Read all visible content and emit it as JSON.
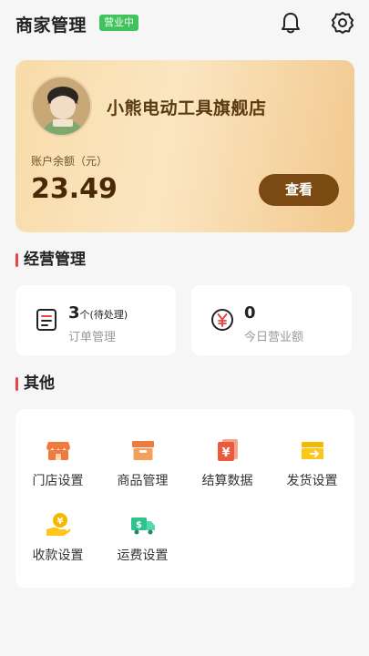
{
  "header": {
    "title": "商家管理",
    "status": "营业中",
    "icons": [
      "bell-icon",
      "gear-icon"
    ]
  },
  "balance_card": {
    "shop_name": "小熊电动工具旗舰店",
    "balance_label": "账户余额（元）",
    "balance_value": "23.49",
    "view_button": "查看"
  },
  "business": {
    "title": "经营管理",
    "orders": {
      "count": "3",
      "sub": "个(待处理)",
      "label": "订单管理"
    },
    "revenue": {
      "value": "0",
      "label": "今日营业额"
    }
  },
  "others": {
    "title": "其他",
    "items": [
      {
        "label": "门店设置",
        "icon": "store-icon"
      },
      {
        "label": "商品管理",
        "icon": "box-icon"
      },
      {
        "label": "结算数据",
        "icon": "settlement-icon"
      },
      {
        "label": "发货设置",
        "icon": "shipping-icon"
      },
      {
        "label": "收款设置",
        "icon": "payment-icon"
      },
      {
        "label": "运费设置",
        "icon": "truck-icon"
      }
    ]
  },
  "colors": {
    "accent_red": "#e84545",
    "status_green": "#3fc35a",
    "button_brown": "#7a4a12",
    "icon_orange": "#f07a3c",
    "icon_yellow": "#f5b800",
    "icon_green": "#2fc28c"
  }
}
